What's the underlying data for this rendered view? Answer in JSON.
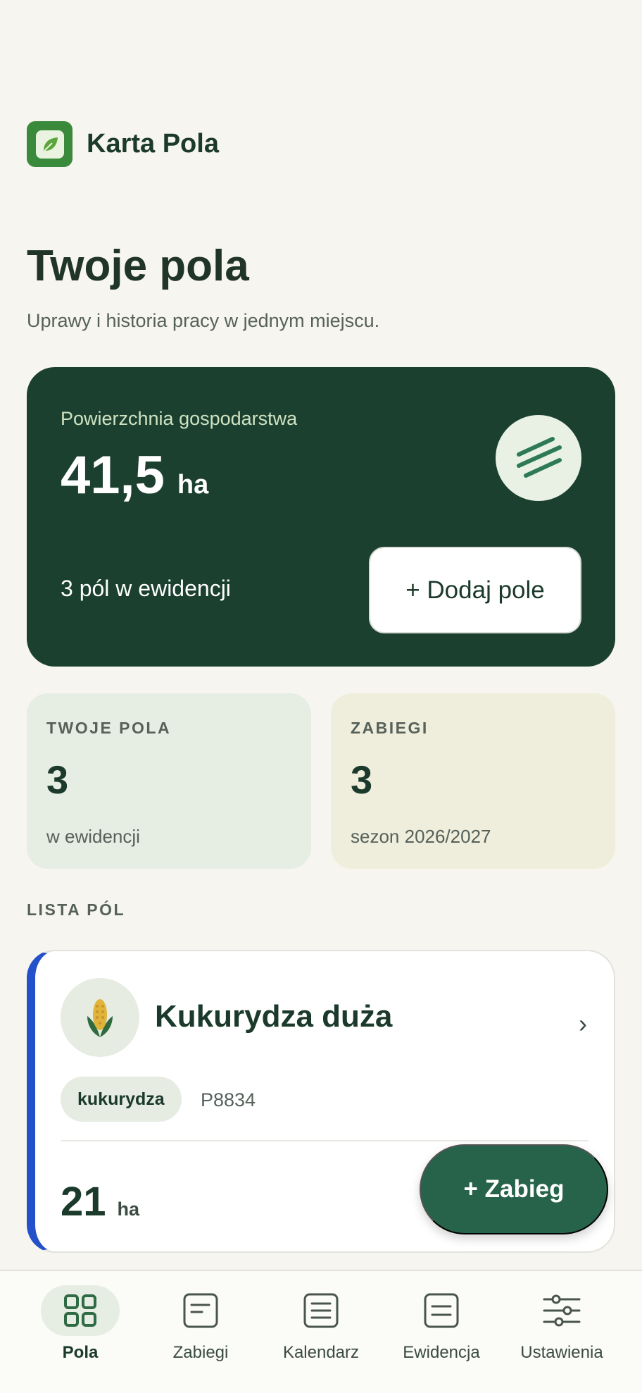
{
  "app": {
    "title": "Karta Pola",
    "accent": "#1b4030",
    "brand_green": "#3a8a3c"
  },
  "page": {
    "title": "Twoje pola",
    "subtitle": "Uprawy i historia pracy w jednym miejscu."
  },
  "hero": {
    "label": "Powierzchnia gospodarstwa",
    "value": "41,5",
    "unit": "ha",
    "count_text": "3 pól w ewidencji",
    "add_button": "+ Dodaj pole",
    "icon": "lines-icon"
  },
  "stats": [
    {
      "label": "TWOJE POLA",
      "value": "3",
      "sub": "w ewidencji"
    },
    {
      "label": "ZABIEGI",
      "value": "3",
      "sub": "sezon 2026/2027"
    }
  ],
  "list": {
    "label": "LISTA PÓL",
    "fields": [
      {
        "name": "Kukurydza duża",
        "crop": "kukurydza",
        "id": "P8834",
        "area": "21",
        "unit": "ha",
        "icon": "corn-icon",
        "accent": "#2450c9"
      }
    ]
  },
  "fab": {
    "label": "+ Zabieg"
  },
  "nav": [
    {
      "label": "Pola",
      "icon": "grid-icon",
      "active": true
    },
    {
      "label": "Zabiegi",
      "icon": "document-icon",
      "active": false
    },
    {
      "label": "Kalendarz",
      "icon": "calendar-icon",
      "active": false
    },
    {
      "label": "Ewidencja",
      "icon": "register-icon",
      "active": false
    },
    {
      "label": "Ustawienia",
      "icon": "sliders-icon",
      "active": false
    }
  ]
}
